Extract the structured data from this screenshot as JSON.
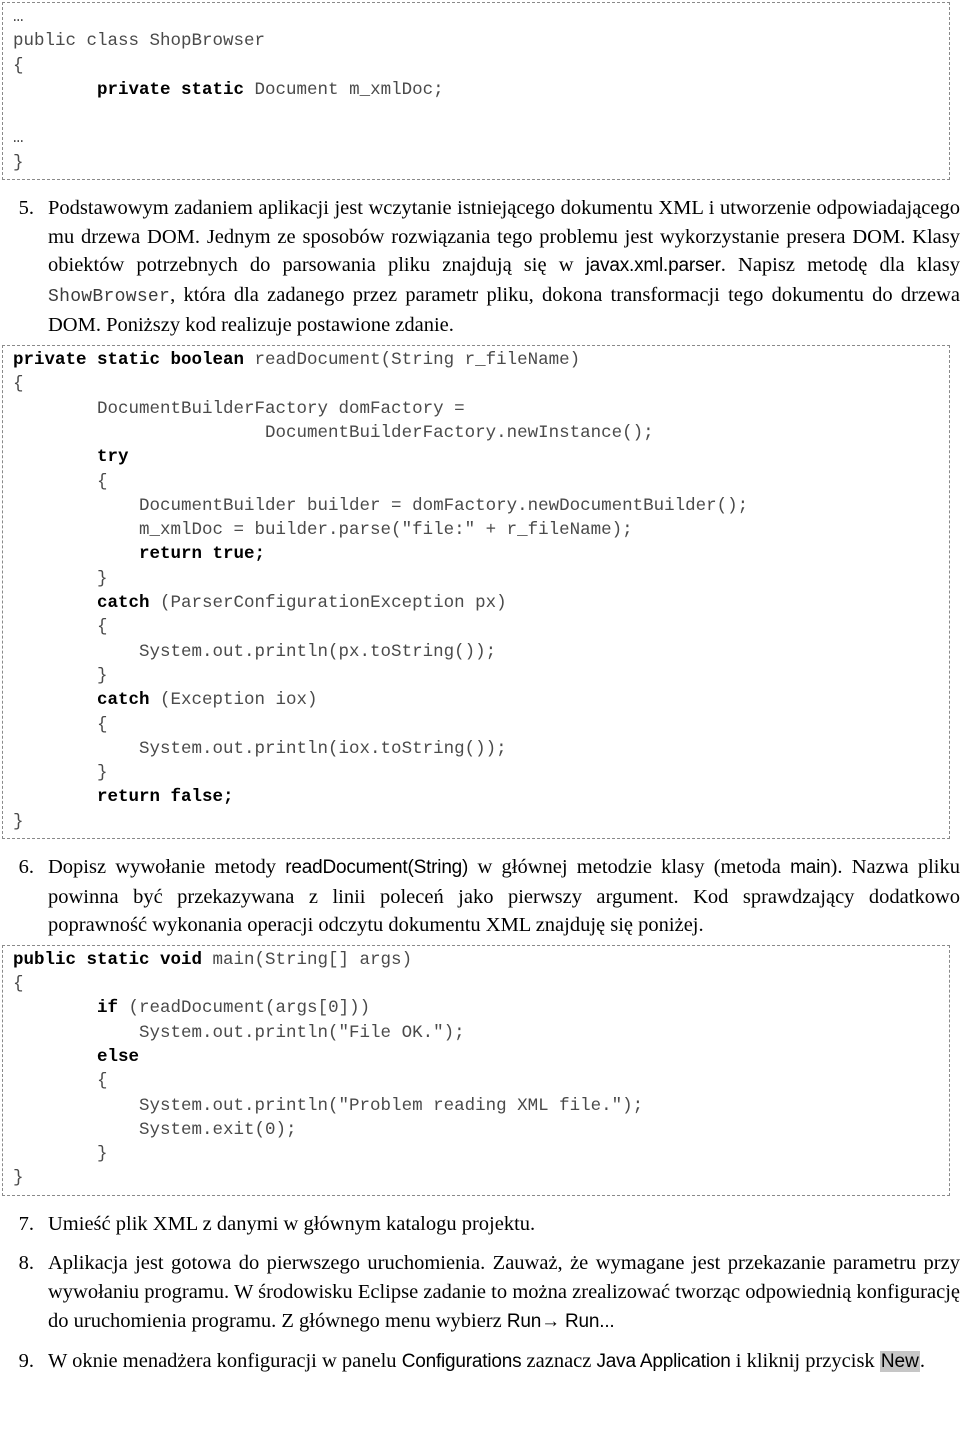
{
  "document": {
    "language": "pl",
    "type": "tutorial-worksheet"
  },
  "code_block_1": {
    "name": "shopbrowser-class-snippet",
    "lines": [
      {
        "plain": "…"
      },
      {
        "plain": "public class ShopBrowser"
      },
      {
        "plain": "{"
      },
      {
        "indent": "        ",
        "bold": "private static",
        "plain": " Document m_xmlDoc;"
      },
      {
        "plain": ""
      },
      {
        "plain": "…"
      },
      {
        "plain": "}"
      }
    ]
  },
  "step5": {
    "number": "5.",
    "p1": "Podstawowym zadaniem aplikacji jest wczytanie istniejącego dokumentu XML i utworzenie odpowiadającego mu drzewa DOM. Jednym ze sposobów rozwiązania tego problemu jest wykorzystanie presera DOM. Klasy obiektów potrzebnych do parsowania pliku znajdują się w ",
    "code1": "javax.xml.parser",
    "p2": ". Napisz metodę dla klasy ",
    "code2": "ShowBrowser",
    "p3": ", która dla zadanego przez parametr pliku, dokona transformacji tego dokumentu do drzewa DOM. Poniższy kod realizuje postawione zdanie."
  },
  "code_block_2": {
    "name": "readdocument-method-snippet",
    "lines": [
      {
        "bold": "private static boolean",
        "plain": " readDocument(String r_fileName)"
      },
      {
        "plain": "{"
      },
      {
        "plain": "        DocumentBuilderFactory domFactory ="
      },
      {
        "plain": "                        DocumentBuilderFactory.newInstance();"
      },
      {
        "indent": "        ",
        "bold": "try"
      },
      {
        "plain": "        {"
      },
      {
        "plain": "            DocumentBuilder builder = domFactory.newDocumentBuilder();"
      },
      {
        "plain": "            m_xmlDoc = builder.parse(\"file:\" + r_fileName);"
      },
      {
        "indent": "            ",
        "bold": "return true;"
      },
      {
        "plain": "        }"
      },
      {
        "indent": "        ",
        "bold": "catch",
        "plain": " (ParserConfigurationException px)"
      },
      {
        "plain": "        {"
      },
      {
        "plain": "            System.out.println(px.toString());"
      },
      {
        "plain": "        }"
      },
      {
        "indent": "        ",
        "bold": "catch",
        "plain": " (Exception iox)"
      },
      {
        "plain": "        {"
      },
      {
        "plain": "            System.out.println(iox.toString());"
      },
      {
        "plain": "        }"
      },
      {
        "indent": "        ",
        "bold": "return false;"
      },
      {
        "plain": "}"
      }
    ]
  },
  "step6": {
    "number": "6.",
    "p1": "Dopisz wywołanie metody ",
    "code1": "readDocument(String)",
    "p2": " w głównej metodzie klasy (metoda ",
    "code2": "main",
    "p3": "). Nazwa pliku powinna być przekazywana z linii poleceń jako pierwszy argument. Kod sprawdzający dodatkowo poprawność wykonania operacji odczytu dokumentu XML znajduję się poniżej."
  },
  "code_block_3": {
    "name": "main-method-snippet",
    "lines": [
      {
        "bold": "public static void",
        "plain": " main(String[] args)"
      },
      {
        "plain": "{"
      },
      {
        "indent": "        ",
        "bold": "if",
        "plain": " (readDocument(args[0]))"
      },
      {
        "plain": "            System.out.println(\"File OK.\");"
      },
      {
        "indent": "        ",
        "bold": "else"
      },
      {
        "plain": "        {"
      },
      {
        "plain": "            System.out.println(\"Problem reading XML file.\");"
      },
      {
        "plain": "            System.exit(0);"
      },
      {
        "plain": "        }"
      },
      {
        "plain": "}"
      }
    ]
  },
  "step7": {
    "number": "7.",
    "p1": "Umieść plik XML z danymi w głównym katalogu projektu."
  },
  "step8": {
    "number": "8.",
    "p1": "Aplikacja jest gotowa do pierwszego uruchomienia. Zauważ, że wymagane jest przekazanie parametru przy wywołaniu programu. W środowisku Eclipse zadanie to można zrealizować tworząc odpowiednią konfigurację do uruchomienia programu. Z głównego menu wybierz ",
    "menu1": "Run",
    "arrow": "→",
    "menu2": " Run..."
  },
  "step9": {
    "number": "9.",
    "p1": "W oknie menadżera konfiguracji w panelu ",
    "ui1": "Configurations",
    "p2": " zaznacz ",
    "ui2": "Java Application",
    "p3": " i kliknij przycisk ",
    "button": "New",
    "p4": "."
  },
  "colors": {
    "code_text": "#4a4a4a",
    "code_keyword": "#000000",
    "border": "#8a8a8a",
    "highlight": "#c6c6c6",
    "body_text": "#000000",
    "background": "#ffffff"
  }
}
